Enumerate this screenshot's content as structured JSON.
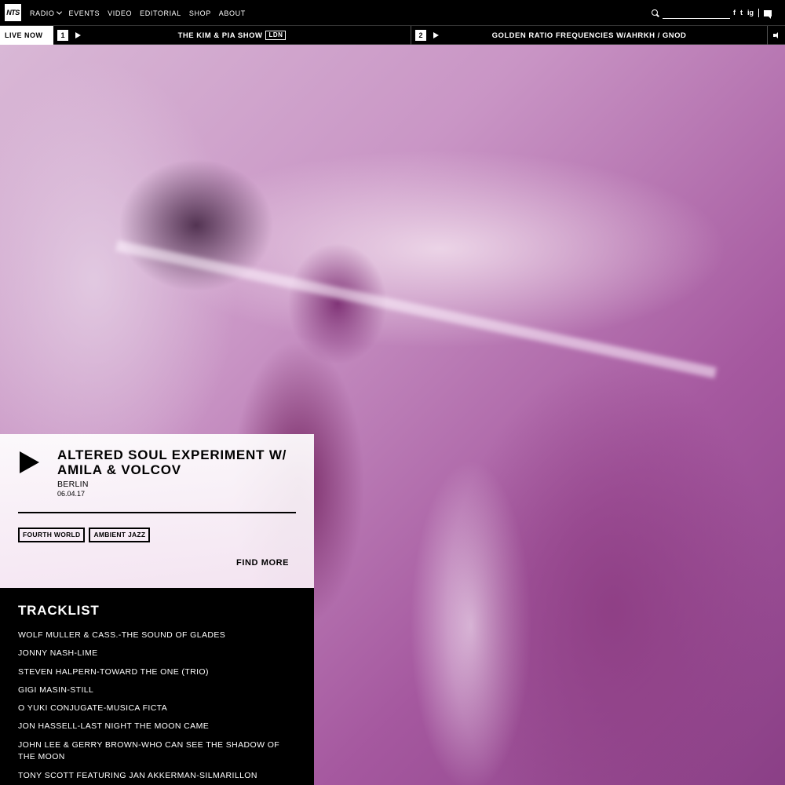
{
  "nav": {
    "logo_text": "NTS",
    "links": [
      "RADIO",
      "EVENTS",
      "VIDEO",
      "EDITORIAL",
      "SHOP",
      "ABOUT"
    ],
    "search_placeholder": "",
    "socials": [
      "f",
      "t",
      "ig"
    ]
  },
  "livebar": {
    "label": "LIVE NOW",
    "channels": [
      {
        "number": "1",
        "title": "THE KIM & PIA SHOW",
        "tag": "LDN"
      },
      {
        "number": "2",
        "title": "GOLDEN RATIO FREQUENCIES W/AHRKH / GNOD",
        "tag": ""
      }
    ]
  },
  "show": {
    "title": "ALTERED SOUL EXPERIMENT W/ AMILA & VOLCOV",
    "location": "BERLIN",
    "date": "06.04.17",
    "tags": [
      "FOURTH WORLD",
      "AMBIENT JAZZ"
    ],
    "find_more": "FIND MORE"
  },
  "tracklist": {
    "title": "TRACKLIST",
    "tracks": [
      "WOLF MULLER & CASS.-THE SOUND OF GLADES",
      "JONNY NASH-LIME",
      "STEVEN HALPERN-TOWARD THE ONE (TRIO)",
      "GIGI MASIN-STILL",
      "O YUKI CONJUGATE-MUSICA FICTA",
      "JON HASSELL-LAST NIGHT THE MOON CAME",
      "JOHN LEE & GERRY BROWN-WHO CAN SEE THE SHADOW OF THE MOON",
      "TONY SCOTT FEATURING JAN AKKERMAN-SILMARILLON"
    ]
  },
  "colors": {
    "background": "#000000",
    "panel": "#ffffff",
    "hero_tint": "#b86fb0"
  }
}
